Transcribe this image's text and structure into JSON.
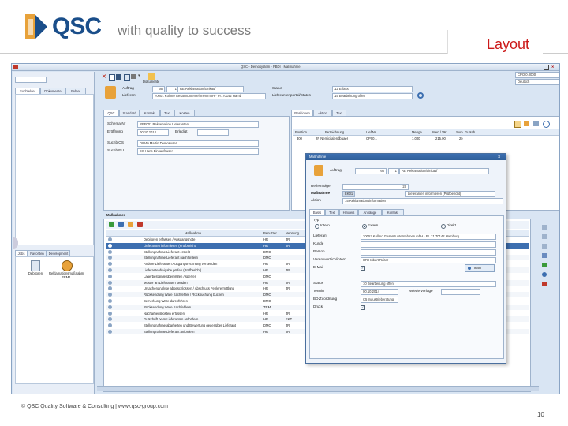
{
  "slide": {
    "logo_text": "QSC",
    "tagline": "with quality to success",
    "title": "Layout",
    "footer": "© QSC Quality Software & Consulting | www.qsc-group.com",
    "page_number": "10"
  },
  "app": {
    "window_title": "QSC - Demosystem - PBDI - Maßnahme",
    "left_tabs": [
      "Suchfelder",
      "Dokumente",
      "Fehler"
    ],
    "toolbar_label": "Dokumente",
    "header": {
      "auftrag_label": "Auftrag",
      "auftrag_nr": "66",
      "auftrag_sub": "1",
      "auftrag_text": "RE Reklamation/Einkauf",
      "lieferant_label": "Lieferant",
      "lieferant_text": "70001 Kollmo Gesamtunternehmen mbH · Pr. 70142 Hamb",
      "status_label": "Status",
      "status_value": "12 Erfasst",
      "lief_status_label": "Lieferantenportal/Status",
      "lief_status_value": "15 Bearbeitung offen",
      "right_top_1": "CPO 0.0000",
      "right_top_2": "Deutsch"
    },
    "main_tabs": [
      "QSC",
      "Standard",
      "Kontakt",
      "Text",
      "Kosten"
    ],
    "form": {
      "schema_label": "Schema-Nr",
      "schema_value": "REF001 Reklamation Lieferanten",
      "eroeffnung_label": "Eröffnung",
      "eroeffnung_value": "00.10.2014",
      "erledigt_label": "Erledigt",
      "suchq_label": "Suchb.QS",
      "suchq_value": "DIP40 Martin Demosuser",
      "suchel_label": "Suchb.ELI",
      "suchel_value": "EK Hans Einkaufsuser"
    },
    "right_tabs": [
      "Positionen",
      "Aktion",
      "Text"
    ],
    "positions": {
      "headers": [
        "Position",
        "Bezeichnung",
        "Lief.Nr",
        "Menge",
        "Wert / VK",
        "Sum. Gutsch"
      ],
      "rows": [
        [
          "300",
          "2P Nemicitalendbuaer",
          "CP00...",
          "1,000",
          "215,00",
          "2e"
        ]
      ]
    },
    "massnahmen_title": "Maßnahmen",
    "massnahmen_headers": [
      "Maßnahme",
      "Benutzer",
      "Nennung"
    ],
    "massnahmen_rows": [
      [
        "Debitoren erfassen / Ausgangsnote",
        "HR",
        "JR"
      ],
      [
        "Lieferanten informieren (Prüfbericht)",
        "HR",
        "JR"
      ],
      [
        "Stellungnahme Lieferant erstellt",
        "DMO",
        ""
      ],
      [
        "Stellungnahme Lieferant nachfordern",
        "DMO",
        ""
      ],
      [
        "Andere Lieferanten Ausgangsrechnung versenden",
        "HR",
        "JR"
      ],
      [
        "Lieferantenfreigabe prüfen (Prüfbericht)",
        "HR",
        "JR"
      ],
      [
        "Lagerbestände überprüfen / sperren",
        "DMO",
        ""
      ],
      [
        "Muster an Lieferanten senden",
        "HR",
        "JR"
      ],
      [
        "Ursachenanalyse abgeschlossen / Abschluss Fehlerermittlung",
        "HR",
        "JR"
      ],
      [
        "Rücksendung Ware Sachfehler / Rückbuchung buchen",
        "DMO",
        ""
      ],
      [
        "Bemerkung Ware durchführen",
        "DMO",
        ""
      ],
      [
        "Rücksendung Ware Sachfehlern",
        "TRM",
        ""
      ],
      [
        "Nacharbeitskosten erfassen",
        "HR",
        "JR"
      ],
      [
        "Gutschrift beim Lieferanten anfordern",
        "HR",
        "EKT"
      ],
      [
        "Stellungnahme abarbeiten und Bewertung gegenüber Lieferant",
        "DMO",
        "JR"
      ],
      [
        "Stellungnahme Lieferant anfordern",
        "HR",
        "JR"
      ]
    ],
    "bottom_left_tabs": [
      "Jobs",
      "Favoriten",
      "Development"
    ],
    "bottom_left_items": [
      "Debitoren",
      "Reklamationsmaßnahme FEM1"
    ]
  },
  "dialog": {
    "title": "Maßnahme",
    "auftrag_label": "Auftrag",
    "auftrag_nr": "66",
    "auftrag_sub": "1",
    "auftrag_text": "RE Reklamation/Einkauf",
    "reihenfolge_label": "Reihenfolge",
    "reihenfolge_value": "23",
    "massnahme_label": "Maßnahme",
    "massnahme_code": "EK01",
    "massnahme_text": "Lieferanten informieren (Prüfbericht)",
    "aktion_label": "Aktion",
    "aktion_value": "15 Reklamationsinformation",
    "tabs": [
      "Basis",
      "Text",
      "Hinweis",
      "Anhänge",
      "Kontakt"
    ],
    "typ_label": "Typ",
    "radio_intern": "Intern",
    "radio_extern": "Extern",
    "radio_direkt": "Direkt",
    "lieferant_label": "Lieferant",
    "lieferant_value": "20053 Kollmo Gesamtunternehmen mbH · Pr. 21 70142 Hamburg",
    "kunde_label": "Kunde",
    "person_label": "Person",
    "verantwortlich_label": "Verantwortlich/intern",
    "verantwortlich_value": "HR Hubert Reiter",
    "email_label": "E-Mail",
    "team_label": "Team",
    "status_label": "Status",
    "status_value": "10 Bearbeitung offen",
    "termin_label": "Termin",
    "termin_value": "00.10.2014",
    "wiedervorlage_label": "Wiedervorlage",
    "bd_label": "BD-Zuordnung",
    "bd_value": "C5 Industrieberatung",
    "print_label": "Druck"
  },
  "colors": {
    "brand_blue": "#1a4e8a",
    "accent_orange": "#e8a23a",
    "title_red": "#cc1a1a",
    "window_bg": "#d9e5f3",
    "dialog_header": "#2f5f99"
  }
}
